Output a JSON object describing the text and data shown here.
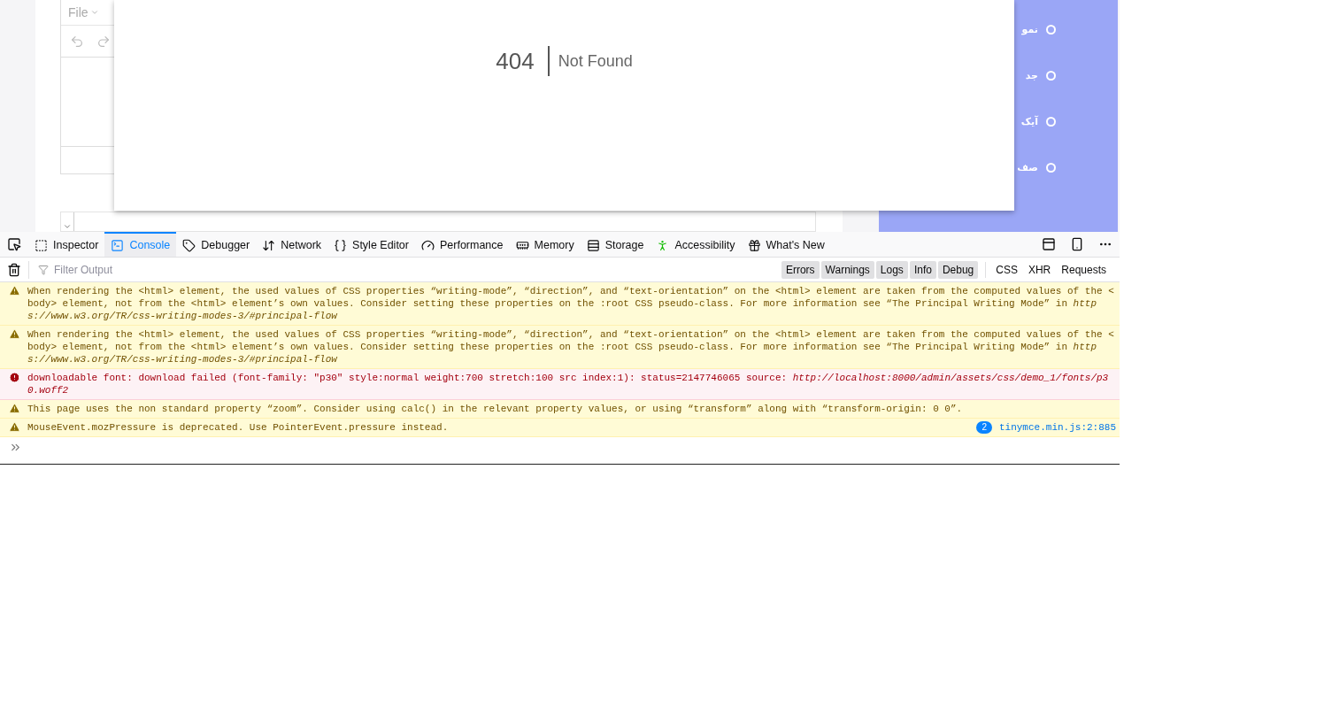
{
  "page": {
    "editor": {
      "menu": "File"
    },
    "error_dialog": {
      "code": "404",
      "message": "Not Found"
    },
    "sidebar": {
      "items": [
        {
          "label": "نمو"
        },
        {
          "label": "جد"
        },
        {
          "label": "آیک"
        },
        {
          "label": "صف"
        }
      ]
    }
  },
  "devtools": {
    "tabs": [
      {
        "label": "Inspector",
        "selected": false
      },
      {
        "label": "Console",
        "selected": true
      },
      {
        "label": "Debugger",
        "selected": false
      },
      {
        "label": "Network",
        "selected": false
      },
      {
        "label": "Style Editor",
        "selected": false
      },
      {
        "label": "Performance",
        "selected": false
      },
      {
        "label": "Memory",
        "selected": false
      },
      {
        "label": "Storage",
        "selected": false
      },
      {
        "label": "Accessibility",
        "selected": false
      },
      {
        "label": "What's New",
        "selected": false
      }
    ],
    "filter": {
      "placeholder": "Filter Output"
    },
    "levels": [
      {
        "label": "Errors",
        "selected": true
      },
      {
        "label": "Warnings",
        "selected": true
      },
      {
        "label": "Logs",
        "selected": true
      },
      {
        "label": "Info",
        "selected": true
      },
      {
        "label": "Debug",
        "selected": true
      }
    ],
    "categories": [
      {
        "label": "CSS",
        "selected": false
      },
      {
        "label": "XHR",
        "selected": false
      },
      {
        "label": "Requests",
        "selected": false
      }
    ],
    "messages": [
      {
        "kind": "warning",
        "text": "When rendering the <html> element, the used values of CSS properties “writing-mode”, “direction”, and “text-orientation” on the <html> element are taken from the computed values of the <body> element, not from the <html> element’s own values. Consider setting these properties on the :root CSS pseudo-class. For more information see “The Principal Writing Mode” in *https://www.w3.org/TR/css-writing-modes-3/#principal-flow*"
      },
      {
        "kind": "warning",
        "text": "When rendering the <html> element, the used values of CSS properties “writing-mode”, “direction”, and “text-orientation” on the <html> element are taken from the computed values of the <body> element, not from the <html> element’s own values. Consider setting these properties on the :root CSS pseudo-class. For more information see “The Principal Writing Mode” in *https://www.w3.org/TR/css-writing-modes-3/#principal-flow*"
      },
      {
        "kind": "error",
        "text": "downloadable font: download failed (font-family: \"p30\" style:normal weight:700 stretch:100 src index:1): status=2147746065 source: *http://localhost:8000/admin/assets/css/demo_1/fonts/p30.woff2*"
      },
      {
        "kind": "warning",
        "text": "This page uses the non standard property “zoom”. Consider using calc() in the relevant property values, or using “transform” along with “transform-origin: 0 0”."
      },
      {
        "kind": "warning",
        "text": "MouseEvent.mozPressure is deprecated. Use PointerEvent.pressure instead.",
        "repeat": "2",
        "source": "tinymce.min.js:2:885"
      }
    ]
  }
}
